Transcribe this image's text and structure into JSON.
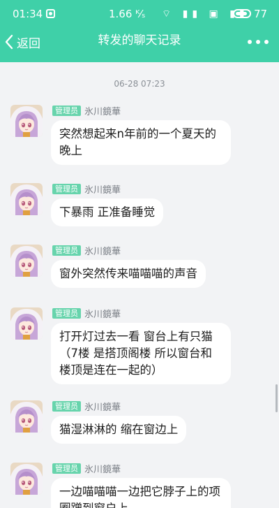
{
  "status_bar": {
    "time": "01:34",
    "network_speed": "1.66 ᴷ⁄ₛ",
    "signal_icons": "⌔ ▮▮ ▣ ▮▮",
    "battery": "77"
  },
  "nav": {
    "back_label": "返回",
    "title": "转发的聊天记录"
  },
  "timestamp": "06-28 07:23",
  "badge_label": "管理员",
  "colors": {
    "header_bg": "#3fd0a8",
    "badge_bg": "#67d4ac",
    "page_bg": "#f2f3f5"
  },
  "messages": [
    {
      "sender": "氷川鏡華",
      "badge": "管理员",
      "text": "突然想起来n年前的一个夏天的晚上"
    },
    {
      "sender": "氷川鏡華",
      "badge": "管理员",
      "text": "下暴雨 正准备睡觉"
    },
    {
      "sender": "氷川鏡華",
      "badge": "管理员",
      "text": "窗外突然传来喵喵喵的声音"
    },
    {
      "sender": "氷川鏡華",
      "badge": "管理员",
      "text": "打开灯过去一看 窗台上有只猫（7楼 是搭顶阁楼 所以窗台和楼顶是连在一起的）"
    },
    {
      "sender": "氷川鏡華",
      "badge": "管理员",
      "text": "猫湿淋淋的 缩在窗边上"
    },
    {
      "sender": "氷川鏡華",
      "badge": "管理员",
      "text": "一边喵喵喵一边把它脖子上的项圈蹭到窗户上"
    }
  ]
}
